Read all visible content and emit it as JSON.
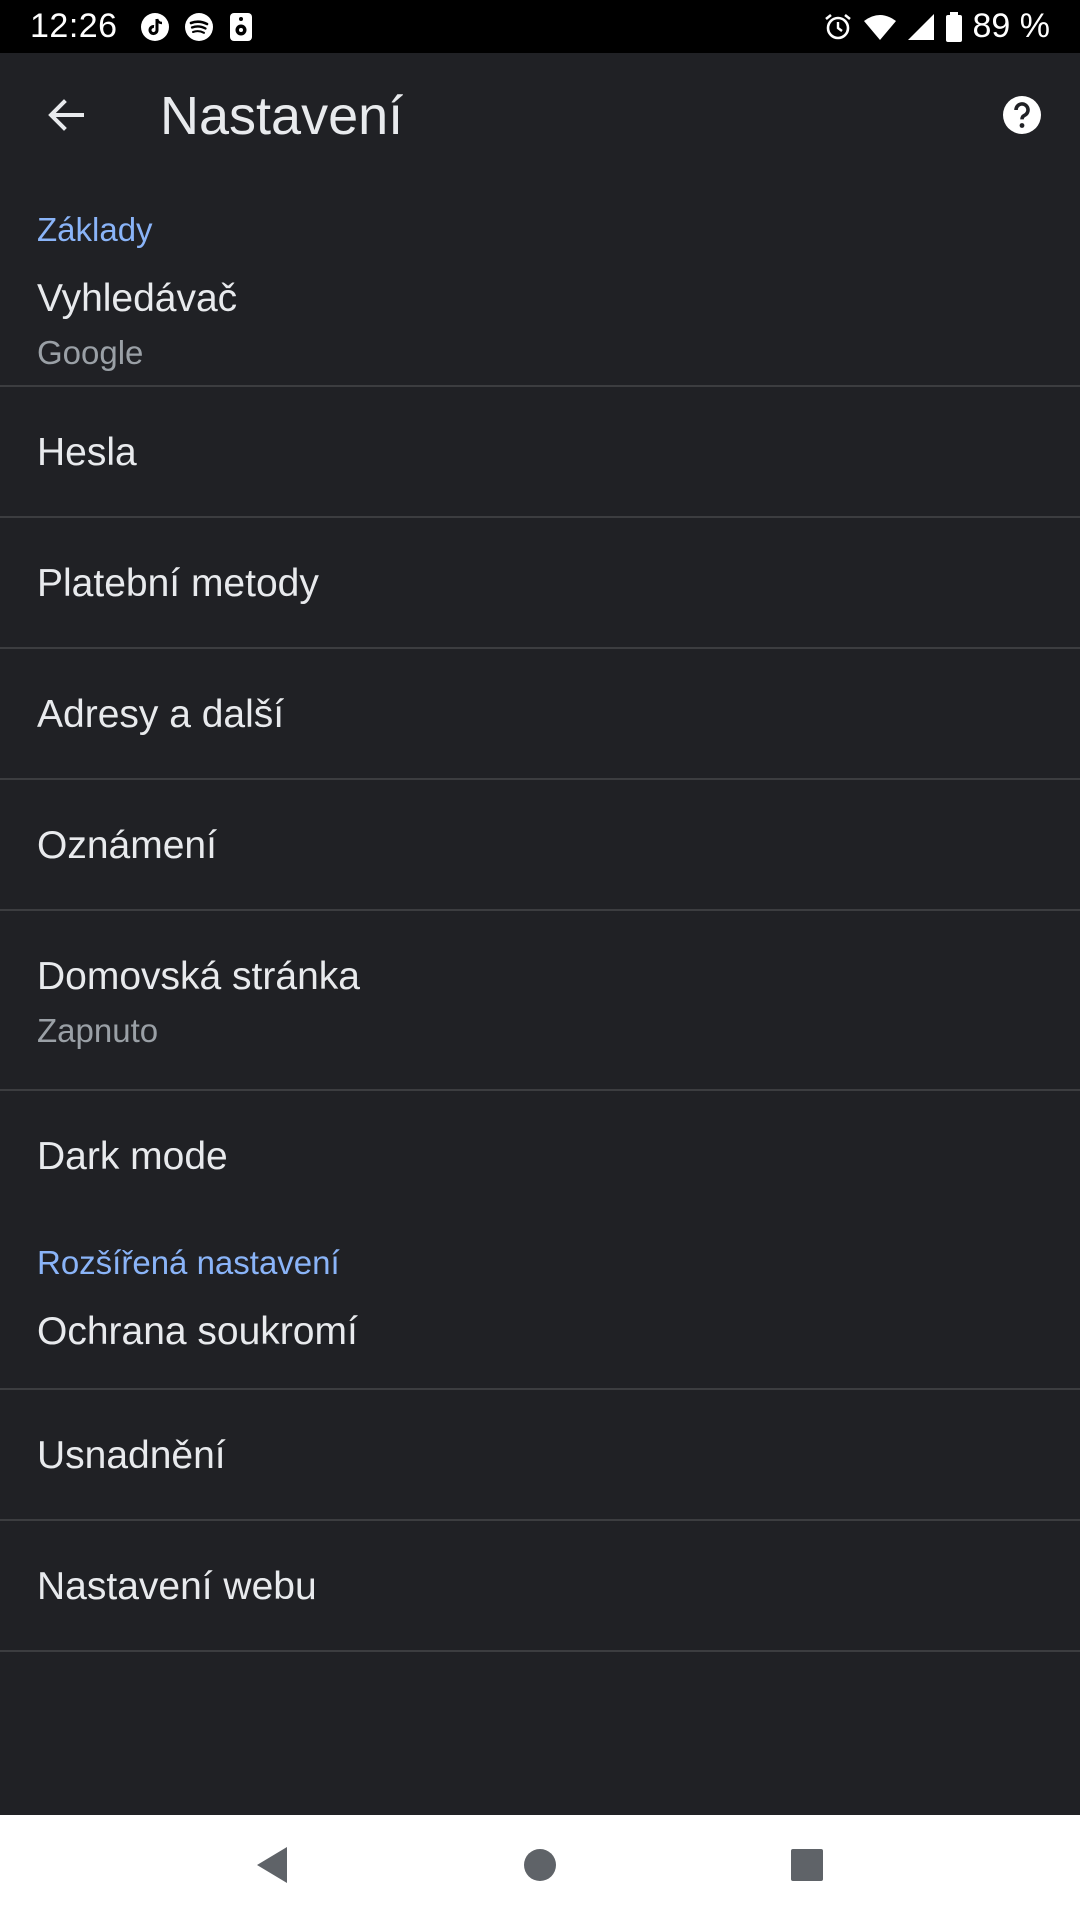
{
  "status_bar": {
    "time": "12:26",
    "battery_percent": "89 %",
    "left_icons": [
      "tiktok-icon",
      "spotify-icon",
      "speaker-icon"
    ],
    "right_icons": [
      "alarm-icon",
      "wifi-icon",
      "signal-icon",
      "battery-icon"
    ]
  },
  "app_bar": {
    "title": "Nastavení",
    "back_icon": "arrow-back-icon",
    "help_icon": "help-icon"
  },
  "sections": {
    "basics": {
      "header": "Základy",
      "items": [
        {
          "title": "Vyhledávač",
          "subtitle": "Google"
        },
        {
          "title": "Hesla"
        },
        {
          "title": "Platební metody"
        },
        {
          "title": "Adresy a další"
        },
        {
          "title": "Oznámení"
        },
        {
          "title": "Domovská stránka",
          "subtitle": "Zapnuto"
        },
        {
          "title": "Dark mode"
        }
      ]
    },
    "advanced": {
      "header": "Rozšířená nastavení",
      "items": [
        {
          "title": "Ochrana soukromí"
        },
        {
          "title": "Usnadnění"
        },
        {
          "title": "Nastavení webu"
        }
      ]
    }
  },
  "nav_bar": {
    "icons": [
      "nav-back-icon",
      "nav-home-icon",
      "nav-recents-icon"
    ]
  },
  "colors": {
    "background": "#202125",
    "accent": "#8ab4f8",
    "text_primary": "#e8eaed",
    "text_secondary": "#9aa0a6",
    "divider": "#3c3d40"
  }
}
